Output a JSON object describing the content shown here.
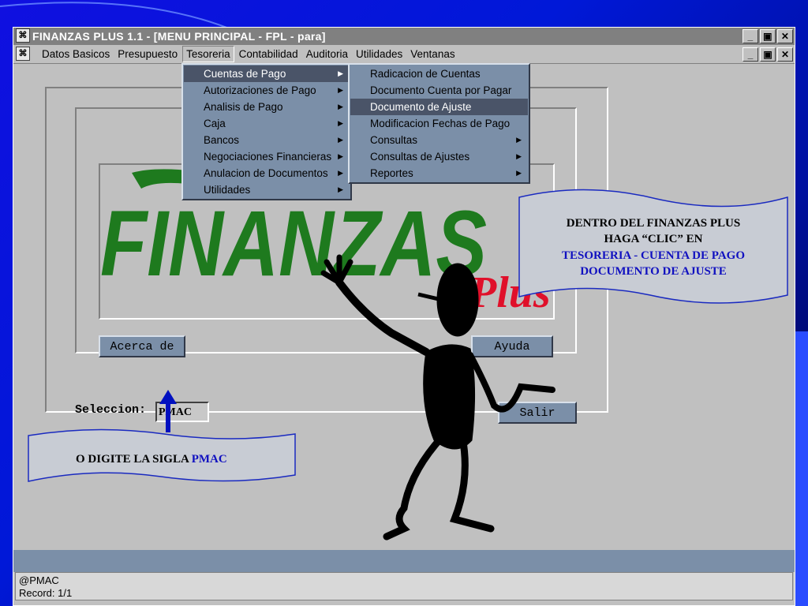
{
  "window": {
    "title": "FINANZAS PLUS 1.1 - [MENU PRINCIPAL - FPL - para]",
    "minimize_glyph": "_",
    "restore_glyph": "▣",
    "close_glyph": "✕"
  },
  "menubar": {
    "items": [
      {
        "label": "Datos Basicos"
      },
      {
        "label": "Presupuesto"
      },
      {
        "label": "Tesoreria"
      },
      {
        "label": "Contabilidad"
      },
      {
        "label": "Auditoria"
      },
      {
        "label": "Utilidades"
      },
      {
        "label": "Ventanas"
      }
    ],
    "active": "Tesoreria"
  },
  "tesoreria_menu": {
    "items": [
      {
        "label": "Cuentas de Pago",
        "submenu": true,
        "highlighted": true
      },
      {
        "label": "Autorizaciones de Pago",
        "submenu": true
      },
      {
        "label": "Analisis de Pago",
        "submenu": true
      },
      {
        "label": "Caja",
        "submenu": true
      },
      {
        "label": "Bancos",
        "submenu": true
      },
      {
        "label": "Negociaciones Financieras",
        "submenu": true
      },
      {
        "label": "Anulacion de Documentos",
        "submenu": true
      },
      {
        "label": "Utilidades",
        "submenu": true
      }
    ]
  },
  "cuentas_submenu": {
    "items": [
      {
        "label": "Radicacion de Cuentas",
        "submenu": false
      },
      {
        "label": "Documento Cuenta por Pagar",
        "submenu": false
      },
      {
        "label": "Documento de Ajuste",
        "submenu": false,
        "highlighted": true
      },
      {
        "label": "Modificacion Fechas de Pago",
        "submenu": false
      },
      {
        "label": "Consultas",
        "submenu": true
      },
      {
        "label": "Consultas de Ajustes",
        "submenu": true
      },
      {
        "label": "Reportes",
        "submenu": true
      }
    ]
  },
  "logo": {
    "main": "FINANZAS",
    "plus": "Plus",
    "main_color": "#1e7a1e",
    "plus_color": "#e0102a"
  },
  "buttons": {
    "acerca": "Acerca de",
    "ayuda": "Ayuda",
    "salir": "Salir"
  },
  "seleccion": {
    "label": "Seleccion:",
    "value": "PMAC"
  },
  "status": {
    "line1": "@PMAC",
    "line2": "Record: 1/1"
  },
  "callout_right": {
    "line1": "DENTRO DEL FINANZAS PLUS",
    "line2": "HAGA “CLIC” EN",
    "line3": "TESORERIA - CUENTA DE PAGO",
    "line4": "DOCUMENTO DE AJUSTE"
  },
  "callout_left": {
    "text": "O DIGITE LA SIGLA ",
    "highlight": "PMAC"
  },
  "colors": {
    "window_bg": "#c0c0c0",
    "menu_bg": "#7b8fa8",
    "menu_highlight": "#4a5468",
    "callout_blue": "#1010c0",
    "callout_bg": "#c8ccd4"
  }
}
